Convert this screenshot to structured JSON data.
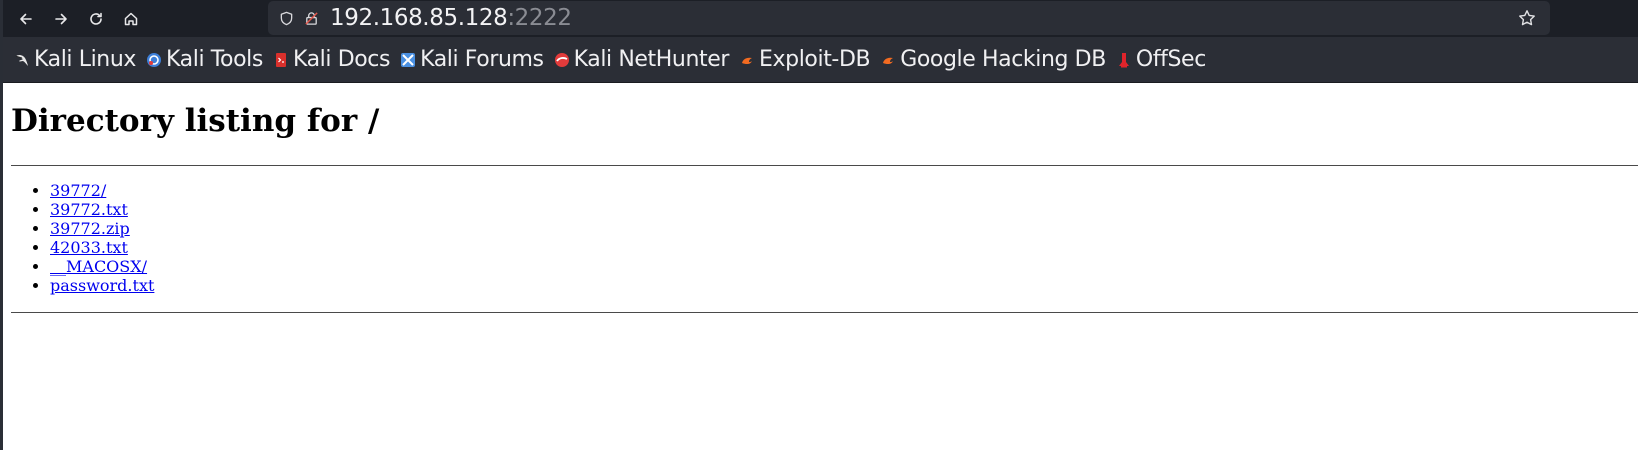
{
  "browser": {
    "url": {
      "host": "192.168.85.128",
      "port": ":2222"
    },
    "nav_icons": [
      "back-arrow-icon",
      "forward-arrow-icon",
      "reload-icon",
      "home-icon"
    ],
    "bookmarks": [
      {
        "label": "Kali Linux",
        "icon": "kali-dragon-icon",
        "color": "#dcdcdc"
      },
      {
        "label": "Kali Tools",
        "icon": "kali-tools-icon",
        "color": "#3d7fd9"
      },
      {
        "label": "Kali Docs",
        "icon": "kali-docs-icon",
        "color": "#d9302c"
      },
      {
        "label": "Kali Forums",
        "icon": "kali-forums-icon",
        "color": "#4a90e2"
      },
      {
        "label": "Kali NetHunter",
        "icon": "kali-nethunter-icon",
        "color": "#e23b3b"
      },
      {
        "label": "Exploit-DB",
        "icon": "exploit-db-icon",
        "color": "#f26b21"
      },
      {
        "label": "Google Hacking DB",
        "icon": "ghdb-icon",
        "color": "#f26b21"
      },
      {
        "label": "OffSec",
        "icon": "offsec-icon",
        "color": "#e0242b"
      }
    ]
  },
  "page": {
    "title": "Directory listing for /",
    "files": [
      {
        "name": "39772/"
      },
      {
        "name": "39772.txt"
      },
      {
        "name": "39772.zip"
      },
      {
        "name": "42033.txt"
      },
      {
        "name": "__MACOSX/"
      },
      {
        "name": "password.txt"
      }
    ]
  }
}
